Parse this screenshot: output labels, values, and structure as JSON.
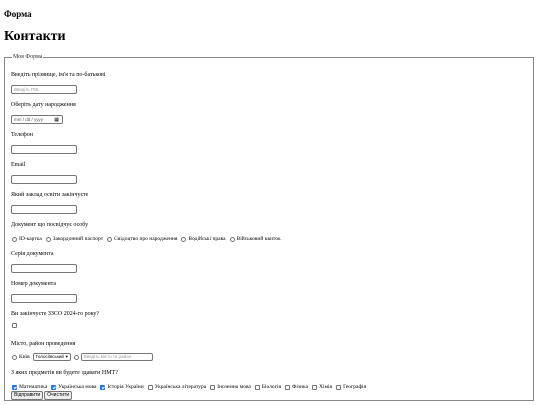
{
  "site_title": "Форма",
  "page_title": "Контакти",
  "form": {
    "legend": "Моя Форма",
    "name_label": "Введіть прізвище, ім'я та по-батькові",
    "name_placeholder": "Введіть ПІБ",
    "dob_label": "Оберіть дату народження",
    "dob_placeholder": "mm / dd / yyyy",
    "phone_label": "Телефон",
    "email_label": "Email",
    "school_label": "Який заклад освіти закінчуєте",
    "doc_label": "Документ що посвідчує особу",
    "doc_options": [
      "ID-картка",
      "Закордонний паспорт",
      "Свідоцтво про народження",
      "Водійські права",
      "Військовий квиток"
    ],
    "doc_series_label": "Серія документа",
    "doc_number_label": "Номер документа",
    "zno_label": "Ви закінчуєте ЗЗСО 2024-го року?",
    "place_label": "Місто, район проведення",
    "city_option": "Київ",
    "district_select": "Голосіївський",
    "place_placeholder": "Введіть місто та район",
    "subjects_label": "З яких предметів ви будете здавати НМТ?",
    "subjects": [
      {
        "label": "Математика",
        "checked": true
      },
      {
        "label": "Українська мова",
        "checked": true
      },
      {
        "label": "Історія України",
        "checked": true
      },
      {
        "label": "Українська література",
        "checked": false
      },
      {
        "label": "Іноземна мова",
        "checked": false
      },
      {
        "label": "Біологія",
        "checked": false
      },
      {
        "label": "Фізика",
        "checked": false
      },
      {
        "label": "Хімія",
        "checked": false
      },
      {
        "label": "Географія",
        "checked": false
      }
    ],
    "submit_label": "Відправити",
    "reset_label": "Очистити"
  }
}
